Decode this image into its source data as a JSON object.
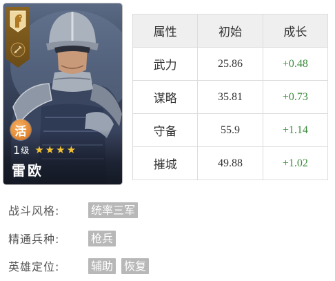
{
  "hero": {
    "name": "雷欧",
    "type_char": "活",
    "level_num": "1",
    "level_unit": "级",
    "stars": 4,
    "faction_icon": "horse-icon",
    "type_icon": "sword-icon"
  },
  "stats": {
    "headers": [
      "属性",
      "初始",
      "成长"
    ],
    "rows": [
      {
        "attr": "武力",
        "initial": "25.86",
        "growth": "+0.48"
      },
      {
        "attr": "谋略",
        "initial": "35.81",
        "growth": "+0.73"
      },
      {
        "attr": "守备",
        "initial": "55.9",
        "growth": "+1.14"
      },
      {
        "attr": "摧城",
        "initial": "49.88",
        "growth": "+1.02"
      }
    ]
  },
  "info": {
    "combat_style": {
      "label": "战斗风格:",
      "tags": [
        "统率三军"
      ]
    },
    "troop_type": {
      "label": "精通兵种:",
      "tags": [
        "枪兵"
      ]
    },
    "role": {
      "label": "英雄定位:",
      "tags": [
        "辅助",
        "恢复"
      ]
    }
  },
  "colors": {
    "growth_text": "#3a8a3a",
    "tag_bg": "#b8b8b8",
    "header_bg": "#efefef",
    "type_circle": "#e38a34",
    "star": "#f2c233"
  }
}
